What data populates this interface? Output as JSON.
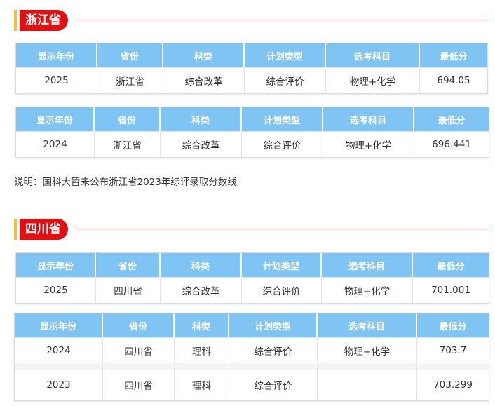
{
  "sections": [
    {
      "title": "浙江省",
      "tables": [
        {
          "headers": [
            "显示年份",
            "省份",
            "科类",
            "计划类型",
            "选考科目",
            "最低分"
          ],
          "rows": [
            [
              "2025",
              "浙江省",
              "综合改革",
              "综合评价",
              "物理+化学",
              "694.05"
            ]
          ]
        },
        {
          "headers": [
            "显示年份",
            "省份",
            "科类",
            "计划类型",
            "选考科目",
            "最低分"
          ],
          "rows": [
            [
              "2024",
              "浙江省",
              "综合改革",
              "综合评价",
              "物理+化学",
              "696.441"
            ]
          ]
        }
      ],
      "note": "说明：国科大暂未公布浙江省2023年综评录取分数线"
    },
    {
      "title": "四川省",
      "tables": [
        {
          "headers": [
            "显示年份",
            "省份",
            "科类",
            "计划类型",
            "选考科目",
            "最低分"
          ],
          "rows": [
            [
              "2025",
              "四川省",
              "综合改革",
              "综合评价",
              "物理+化学",
              "701.001"
            ]
          ]
        },
        {
          "headers": [
            "显示年份",
            "省份",
            "科类",
            "计划类型",
            "选考科目",
            "最低分"
          ],
          "rows": [
            [
              "2024",
              "四川省",
              "理科",
              "综合评价",
              "物理+化学",
              "703.7"
            ],
            [
              "2023",
              "四川省",
              "理科",
              "综合评价",
              "",
              "703.299"
            ]
          ]
        }
      ]
    }
  ]
}
